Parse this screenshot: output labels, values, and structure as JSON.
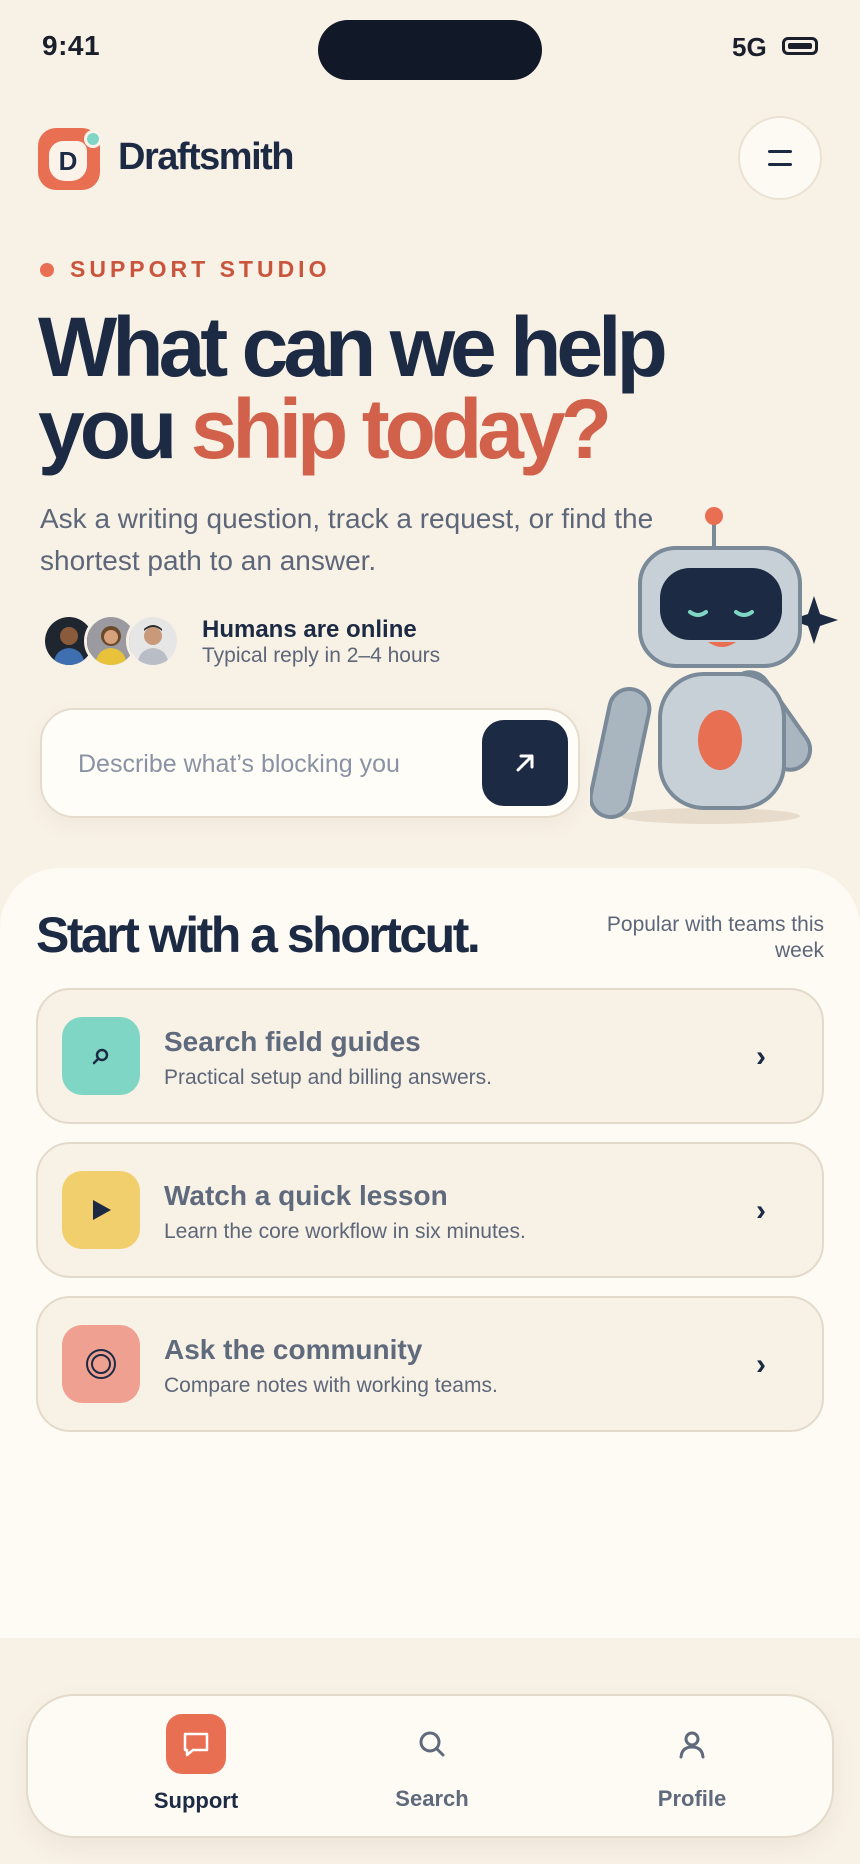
{
  "status_bar": {
    "time": "9:41",
    "network": "5G"
  },
  "header": {
    "brand_name": "Draftsmith",
    "logo_letter": "D"
  },
  "hero": {
    "eyebrow": "SUPPORT STUDIO",
    "headline_part1": "What can we help you",
    "headline_accent": "ship today?",
    "subtext": "Ask a writing question, track a request, or find the shortest path to an answer.",
    "online_title": "Humans are online",
    "online_subtitle": "Typical reply in 2–4 hours",
    "search_placeholder": "Describe what’s blocking you"
  },
  "shortcuts": {
    "title": "Start with a shortcut.",
    "note": "Popular with teams this week",
    "items": [
      {
        "title": "Search field guides",
        "subtitle": "Practical setup and billing answers.",
        "icon": "magnifier-icon",
        "color": "#7fd6c4"
      },
      {
        "title": "Watch a quick lesson",
        "subtitle": "Learn the core workflow in six minutes.",
        "icon": "play-icon",
        "color": "#f2cf6d"
      },
      {
        "title": "Ask the community",
        "subtitle": "Compare notes with working teams.",
        "icon": "target-icon",
        "color": "#f0a090"
      }
    ]
  },
  "nav": {
    "items": [
      {
        "label": "Support",
        "icon": "chat-icon",
        "active": true
      },
      {
        "label": "Search",
        "icon": "search-icon",
        "active": false
      },
      {
        "label": "Profile",
        "icon": "user-icon",
        "active": false
      }
    ]
  },
  "colors": {
    "accent": "#e96f52",
    "navy": "#1c2a44",
    "background": "#f8f1e6"
  }
}
